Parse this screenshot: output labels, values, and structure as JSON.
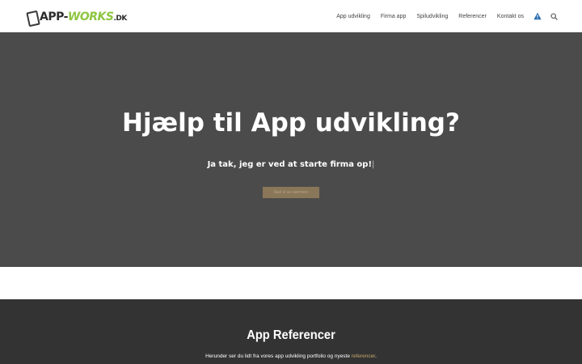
{
  "brand": {
    "logo_main": "APP-",
    "logo_accent": "WORKS",
    "logo_suffix": ".DK"
  },
  "nav": {
    "items": [
      "App udvikling",
      "Firma app",
      "Spiludvikling",
      "Referencer",
      "Kontakt os"
    ]
  },
  "colors": {
    "accent_green": "#8dc63f",
    "hero_bg": "#4b4b4b",
    "refs_bg": "#333333",
    "button_bg": "#8a7659",
    "link": "#c8a96a"
  },
  "hero": {
    "title": "Hjælp til App udvikling?",
    "subtitle": "Ja tak, jeg er ved at starte firma op!",
    "caret": "|",
    "button_label": "Skal vi se nærmere"
  },
  "references": {
    "title": "App Referencer",
    "text_before": "Herunder ser du lidt fra vores app udvikling portfolio og nyeste ",
    "link_text": "referencer",
    "text_after": "."
  },
  "icons": {
    "warning": "warning-triangle-icon",
    "search": "search-icon"
  }
}
